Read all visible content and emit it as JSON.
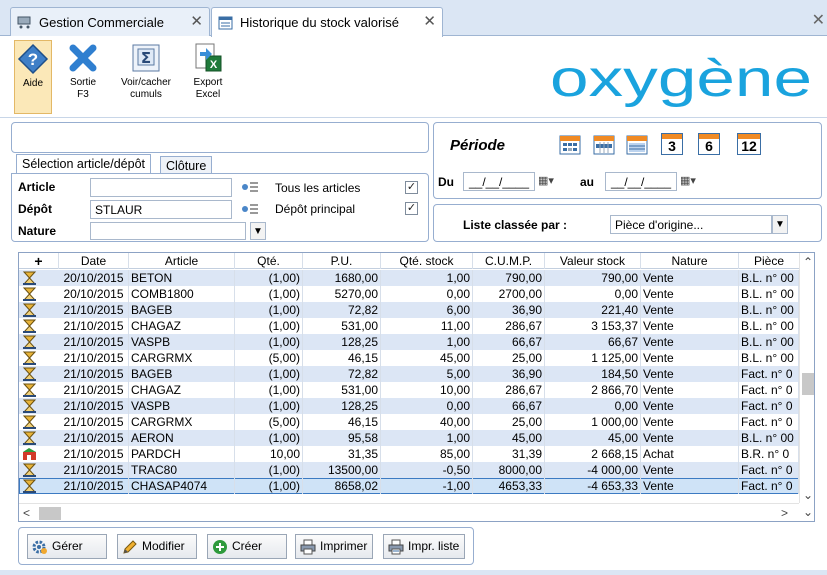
{
  "tabs": [
    {
      "label": "Gestion Commerciale",
      "active": false
    },
    {
      "label": "Historique du stock valorisé",
      "active": true
    }
  ],
  "toolbar": {
    "aide": "Aide",
    "sortie_1": "Sortie",
    "sortie_2": "F3",
    "cumuls_1": "Voir/cacher",
    "cumuls_2": "cumuls",
    "export_1": "Export",
    "export_2": "Excel"
  },
  "logo_text": "oxygène",
  "selection": {
    "tab_selection": "Sélection article/dépôt",
    "tab_cloture": "Clôture",
    "article_label": "Article",
    "article_value": "",
    "depot_label": "Dépôt",
    "depot_value": "STLAUR",
    "nature_label": "Nature",
    "nature_value": "",
    "tous_articles": "Tous les articles",
    "tous_articles_checked": "✓",
    "depot_principal": "Dépôt principal",
    "depot_principal_checked": "✓"
  },
  "periode": {
    "title": "Période",
    "du_label": "Du",
    "du_value": "__/__/____",
    "au_label": "au",
    "au_value": "__/__/____",
    "btn_3": "3",
    "btn_6": "6",
    "btn_12": "12"
  },
  "tri": {
    "label": "Liste classée par :",
    "value": "Pièce d'origine..."
  },
  "grid": {
    "add_symbol": "+",
    "columns": [
      "Date",
      "Article",
      "Qté.",
      "P.U.",
      "Qté. stock",
      "C.U.M.P.",
      "Valeur stock",
      "Nature",
      "Pièce"
    ],
    "rows": [
      {
        "type": "vente",
        "date": "20/10/2015",
        "article": "BETON",
        "qte": "(1,00)",
        "pu": "1680,00",
        "qstock": "1,00",
        "cump": "790,00",
        "valeur": "790,00",
        "nature": "Vente",
        "piece": "B.L. n° 00"
      },
      {
        "type": "vente",
        "date": "20/10/2015",
        "article": "COMB1800",
        "qte": "(1,00)",
        "pu": "5270,00",
        "qstock": "0,00",
        "cump": "2700,00",
        "valeur": "0,00",
        "nature": "Vente",
        "piece": "B.L. n° 00"
      },
      {
        "type": "vente",
        "date": "21/10/2015",
        "article": "BAGEB",
        "qte": "(1,00)",
        "pu": "72,82",
        "qstock": "6,00",
        "cump": "36,90",
        "valeur": "221,40",
        "nature": "Vente",
        "piece": "B.L. n° 00"
      },
      {
        "type": "vente",
        "date": "21/10/2015",
        "article": "CHAGAZ",
        "qte": "(1,00)",
        "pu": "531,00",
        "qstock": "11,00",
        "cump": "286,67",
        "valeur": "3 153,37",
        "nature": "Vente",
        "piece": "B.L. n° 00"
      },
      {
        "type": "vente",
        "date": "21/10/2015",
        "article": "VASPB",
        "qte": "(1,00)",
        "pu": "128,25",
        "qstock": "1,00",
        "cump": "66,67",
        "valeur": "66,67",
        "nature": "Vente",
        "piece": "B.L. n° 00"
      },
      {
        "type": "vente",
        "date": "21/10/2015",
        "article": "CARGRMX",
        "qte": "(5,00)",
        "pu": "46,15",
        "qstock": "45,00",
        "cump": "25,00",
        "valeur": "1 125,00",
        "nature": "Vente",
        "piece": "B.L. n° 00"
      },
      {
        "type": "vente",
        "date": "21/10/2015",
        "article": "BAGEB",
        "qte": "(1,00)",
        "pu": "72,82",
        "qstock": "5,00",
        "cump": "36,90",
        "valeur": "184,50",
        "nature": "Vente",
        "piece": "Fact. n° 0"
      },
      {
        "type": "vente",
        "date": "21/10/2015",
        "article": "CHAGAZ",
        "qte": "(1,00)",
        "pu": "531,00",
        "qstock": "10,00",
        "cump": "286,67",
        "valeur": "2 866,70",
        "nature": "Vente",
        "piece": "Fact. n° 0"
      },
      {
        "type": "vente",
        "date": "21/10/2015",
        "article": "VASPB",
        "qte": "(1,00)",
        "pu": "128,25",
        "qstock": "0,00",
        "cump": "66,67",
        "valeur": "0,00",
        "nature": "Vente",
        "piece": "Fact. n° 0"
      },
      {
        "type": "vente",
        "date": "21/10/2015",
        "article": "CARGRMX",
        "qte": "(5,00)",
        "pu": "46,15",
        "qstock": "40,00",
        "cump": "25,00",
        "valeur": "1 000,00",
        "nature": "Vente",
        "piece": "Fact. n° 0"
      },
      {
        "type": "vente",
        "date": "21/10/2015",
        "article": "AERON",
        "qte": "(1,00)",
        "pu": "95,58",
        "qstock": "1,00",
        "cump": "45,00",
        "valeur": "45,00",
        "nature": "Vente",
        "piece": "B.L. n° 00"
      },
      {
        "type": "achat",
        "date": "21/10/2015",
        "article": "PARDCH",
        "qte": "10,00",
        "pu": "31,35",
        "qstock": "85,00",
        "cump": "31,39",
        "valeur": "2 668,15",
        "nature": "Achat",
        "piece": "B.R. n° 0"
      },
      {
        "type": "vente",
        "date": "21/10/2015",
        "article": "TRAC80",
        "qte": "(1,00)",
        "pu": "13500,00",
        "qstock": "-0,50",
        "cump": "8000,00",
        "valeur": "-4 000,00",
        "nature": "Vente",
        "piece": "Fact. n° 0"
      },
      {
        "type": "vente",
        "date": "21/10/2015",
        "article": "CHASAP4074",
        "qte": "(1,00)",
        "pu": "8658,02",
        "qstock": "-1,00",
        "cump": "4653,33",
        "valeur": "-4 653,33",
        "nature": "Vente",
        "piece": "Fact. n° 0"
      }
    ]
  },
  "buttons": {
    "gerer": "Gérer",
    "modifier": "Modifier",
    "creer": "Créer",
    "imprimer": "Imprimer",
    "impr_liste": "Impr. liste"
  }
}
